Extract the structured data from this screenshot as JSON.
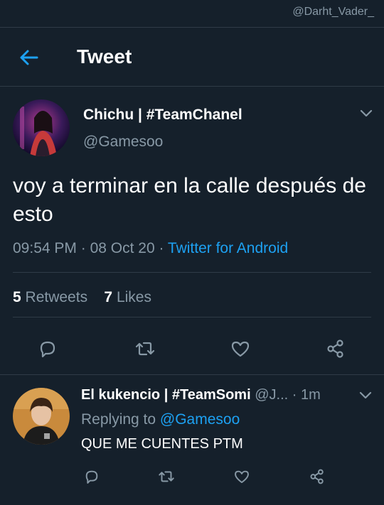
{
  "watermark": "@Darht_Vader_",
  "header": {
    "title": "Tweet",
    "back_icon": "arrow-left-icon",
    "accent": "#1da1f2"
  },
  "tweet": {
    "author_name": "Chichu | #TeamChanel",
    "author_handle": "@Gamesoo",
    "text": "voy a terminar en la calle después de esto",
    "time": "09:54 PM",
    "sep1": " · ",
    "date": "08 Oct 20",
    "sep2": " · ",
    "source": "Twitter for Android",
    "retweets_count": "5",
    "retweets_label": "Retweets",
    "likes_count": "7",
    "likes_label": "Likes"
  },
  "reply": {
    "author_name": "El kukencio | #TeamSomi",
    "author_handle": "@J...",
    "age": "· 1m",
    "replying_label": "Replying to",
    "replying_handle": "@Gamesoo",
    "text": "QUE ME CUENTES PTM"
  },
  "colors": {
    "background": "#15202b",
    "muted": "#8899a6",
    "divider": "#2f3b47",
    "link": "#1da1f2"
  }
}
